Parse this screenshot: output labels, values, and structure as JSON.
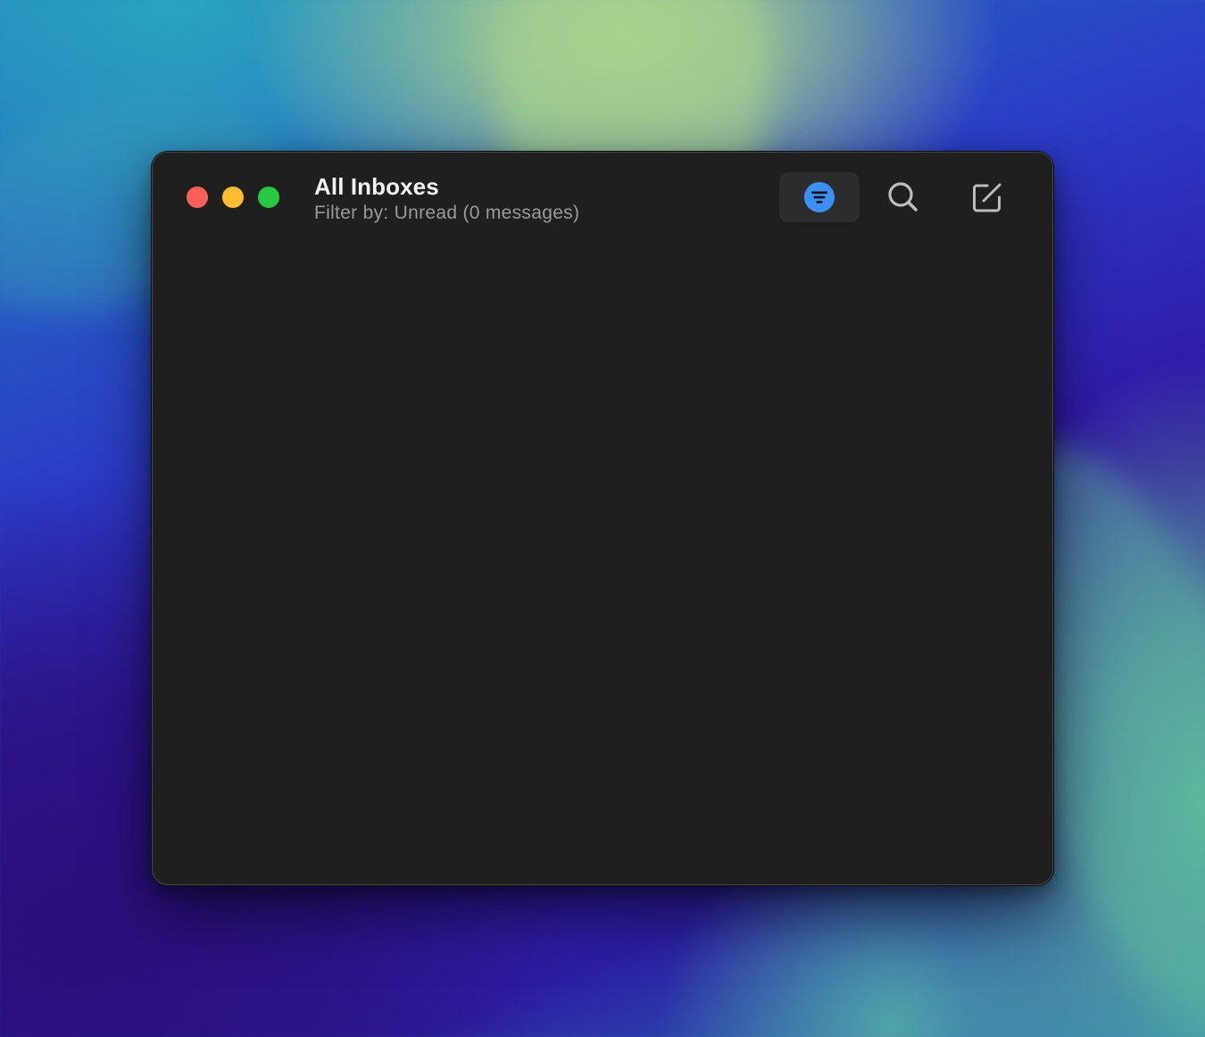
{
  "window": {
    "title": "All Inboxes",
    "subtitle": "Filter by: Unread (0 messages)"
  },
  "traffic_lights": {
    "close_color": "#fe5f57",
    "minimize_color": "#febc2e",
    "zoom_color": "#28c840"
  },
  "toolbar": {
    "filter": {
      "icon": "filter-icon",
      "active": true,
      "accent_color": "#3b8ff5"
    },
    "search": {
      "icon": "search-icon"
    },
    "compose": {
      "icon": "compose-icon"
    }
  },
  "message_list": {
    "count": 0
  }
}
